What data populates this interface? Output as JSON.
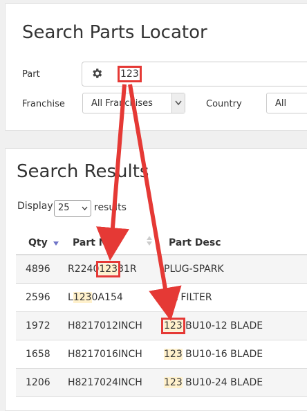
{
  "search": {
    "title": "Search Parts Locator",
    "part_label": "Part",
    "part_value": "123",
    "franchise_label": "Franchise",
    "franchise_value": "All Franchises",
    "country_label": "Country",
    "country_value": "All"
  },
  "results": {
    "title": "Search Results",
    "display_prefix": "Display",
    "page_size": "25",
    "display_suffix": "results",
    "columns": {
      "qty": "Qty",
      "part_no": "Part N",
      "part_desc": "Part Desc"
    },
    "rows": [
      {
        "qty": "4896",
        "part_pre": "R2240",
        "part_hl": "123",
        "part_post": "31R",
        "desc_pre": "",
        "desc_hl": "",
        "desc_post": "PLUG-SPARK"
      },
      {
        "qty": "2596",
        "part_pre": "L",
        "part_hl": "123",
        "part_post": "0A154",
        "desc_pre": "",
        "desc_hl": "",
        "desc_post": "IL FILTER"
      },
      {
        "qty": "1972",
        "part_pre": "H8217012INCH",
        "part_hl": "",
        "part_post": "",
        "desc_pre": "",
        "desc_hl": "123",
        "desc_post": " BU10-12 BLADE"
      },
      {
        "qty": "1658",
        "part_pre": "H8217016INCH",
        "part_hl": "",
        "part_post": "",
        "desc_pre": "",
        "desc_hl": "123",
        "desc_post": " BU10-16 BLADE"
      },
      {
        "qty": "1206",
        "part_pre": "H8217024INCH",
        "part_hl": "",
        "part_post": "",
        "desc_pre": "",
        "desc_hl": "123",
        "desc_post": " BU10-24 BLADE"
      }
    ]
  },
  "colors": {
    "annotation": "#e53935",
    "highlight": "#fff1cc",
    "sort_arrow": "#6f74c7"
  },
  "icons": {
    "settings": "gear-icon",
    "sort": "sort-desc-icon"
  }
}
